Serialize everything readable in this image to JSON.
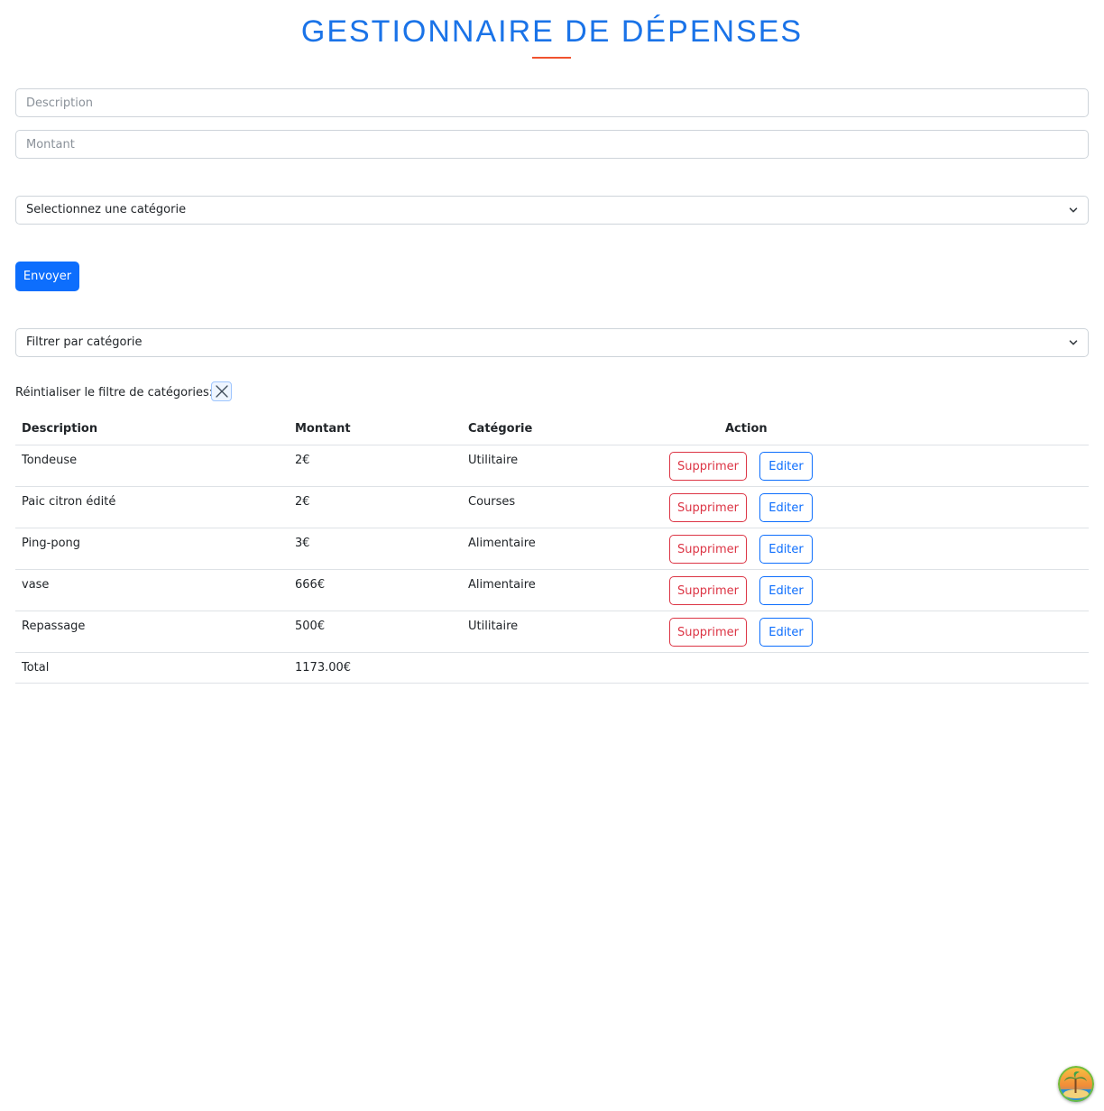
{
  "header": {
    "title": "GESTIONNAIRE DE DÉPENSES"
  },
  "form": {
    "description_placeholder": "Description",
    "amount_placeholder": "Montant",
    "category_select_value": "Selectionnez une catégorie",
    "submit_label": "Envoyer"
  },
  "filter": {
    "select_value": "Filtrer par catégorie",
    "reset_label": "Réintialiser le filtre de catégories:"
  },
  "table": {
    "headers": [
      "Description",
      "Montant",
      "Catégorie",
      "Action"
    ],
    "rows": [
      {
        "description": "Tondeuse",
        "amount": "2€",
        "category": "Utilitaire",
        "delete_label": "Supprimer",
        "edit_label": "Editer"
      },
      {
        "description": "Paic citron édité",
        "amount": "2€",
        "category": "Courses",
        "delete_label": "Supprimer",
        "edit_label": "Editer"
      },
      {
        "description": "Ping-pong",
        "amount": "3€",
        "category": "Alimentaire",
        "delete_label": "Supprimer",
        "edit_label": "Editer"
      },
      {
        "description": "vase",
        "amount": "666€",
        "category": "Alimentaire",
        "delete_label": "Supprimer",
        "edit_label": "Editer"
      },
      {
        "description": "Repassage",
        "amount": "500€",
        "category": "Utilitaire",
        "delete_label": "Supprimer",
        "edit_label": "Editer"
      }
    ],
    "total_label": "Total",
    "total_value": "1173.00€"
  },
  "colors": {
    "title": "#1a73e8",
    "accent_underline": "#f0522e",
    "primary": "#0d6efd",
    "danger": "#dc3545"
  },
  "icons": {
    "select_arrow": "chevron-down-icon",
    "reset": "close-icon",
    "avatar": "beach-avatar-icon"
  }
}
